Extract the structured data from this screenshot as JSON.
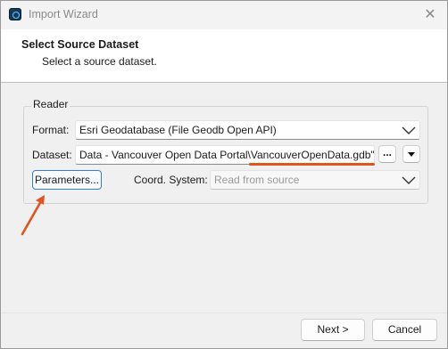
{
  "window": {
    "title": "Import Wizard",
    "close_glyph": "✕",
    "app_icon": "import-wizard-app-icon"
  },
  "header": {
    "title": "Select Source Dataset",
    "subtitle": "Select a source dataset."
  },
  "reader": {
    "group_title": "Reader",
    "format": {
      "label": "Format:",
      "value": "Esri Geodatabase (File Geodb Open API)"
    },
    "dataset": {
      "label": "Dataset:",
      "value": "Data - Vancouver Open Data Portal\\VancouverOpenData.gdb\"",
      "browse_label": "...",
      "menu_icon": "triangle-down-icon"
    },
    "parameters_label": "Parameters...",
    "coord_system": {
      "label": "Coord. System:",
      "value": "Read from source"
    }
  },
  "annotations": {
    "underline_color": "#e0541e",
    "arrow_color": "#e0541e"
  },
  "footer": {
    "next_label": "Next >",
    "cancel_label": "Cancel"
  },
  "colors": {
    "accent": "#3a7bd5",
    "highlight": "#e0541e"
  }
}
